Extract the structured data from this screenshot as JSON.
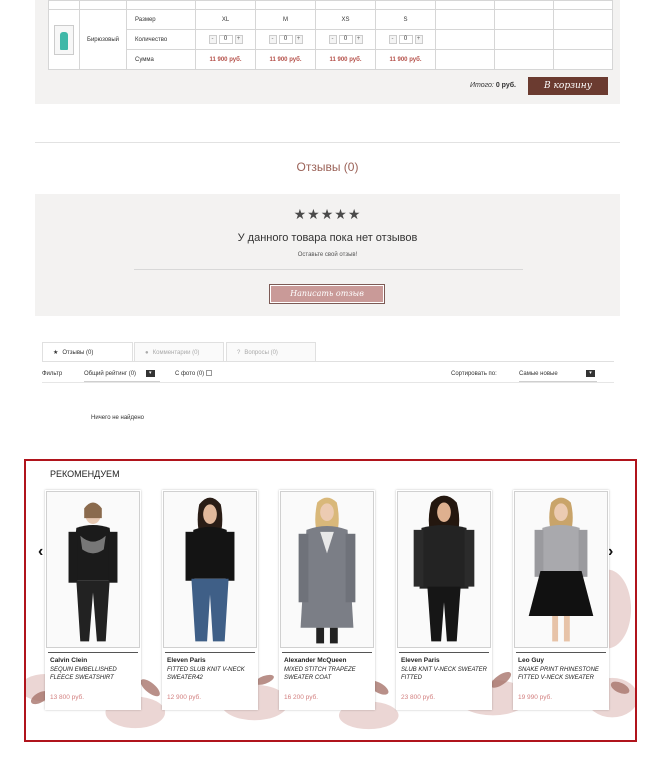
{
  "variants": {
    "color": "Бирюзовый",
    "row_labels": {
      "size": "Размер",
      "quantity": "Количество",
      "sum": "Сумма"
    },
    "sizes": [
      {
        "size": "XL",
        "qty": "0",
        "sum": "11 900 руб."
      },
      {
        "size": "M",
        "qty": "0",
        "sum": "11 900 руб."
      },
      {
        "size": "XS",
        "qty": "0",
        "sum": "11 900 руб."
      },
      {
        "size": "S",
        "qty": "0",
        "sum": "11 900 руб."
      }
    ],
    "qty_minus": "-",
    "qty_plus": "+",
    "total_label": "Итого:",
    "total_value": "0 руб.",
    "cart_button": "В корзину"
  },
  "reviews": {
    "title": "Отзывы (0)",
    "stars": "★★★★★",
    "no_reviews": "У данного товара пока нет отзывов",
    "leave_prompt": "Оставьте свой отзыв!",
    "write_button": "Написать отзыв"
  },
  "tabs": [
    {
      "label": "Отзывы (0)",
      "icon": "star-icon",
      "glyph": "★"
    },
    {
      "label": "Комментарии (0)",
      "icon": "comment-icon",
      "glyph": "●"
    },
    {
      "label": "Вопросы (0)",
      "icon": "question-icon",
      "glyph": "?"
    }
  ],
  "filter": {
    "label": "Фильтр",
    "rating": "Общий рейтинг (0)",
    "photo": "С фото (0)",
    "sort_label": "Сортировать по:",
    "sort_value": "Самые новые",
    "dropdown_glyph": "▾",
    "nothing_found": "Ничего не найдено"
  },
  "recommended": {
    "title": "РЕКОМЕНДУЕМ",
    "prev": "‹",
    "next": "›",
    "products": [
      {
        "brand": "Calvin Clein",
        "name": "SEQUIN EMBELLISHED FLEECE SWEATSHIRT",
        "price": "13 800 руб."
      },
      {
        "brand": "Eleven Paris",
        "name": "FITTED SLUB KNIT V-NECK SWEATER42",
        "price": "12 900 руб."
      },
      {
        "brand": "Alexander McQueen",
        "name": "MIXED STITCH TRAPEZE SWEATER COAT",
        "price": "16 200 руб."
      },
      {
        "brand": "Eleven Paris",
        "name": "SLUB KNIT V-NECK SWEATER FITTED",
        "price": "23 800 руб."
      },
      {
        "brand": "Leo Guy",
        "name": "SNAKE PRINT RHINESTONE FITTED V-NECK SWEATER",
        "price": "19 990 руб."
      }
    ]
  },
  "colors": {
    "accent_brown": "#6b3b30",
    "review_title": "#9b6258",
    "price_red": "#b5514a",
    "card_price": "#d27f7f",
    "highlight_border": "#b0141c"
  }
}
